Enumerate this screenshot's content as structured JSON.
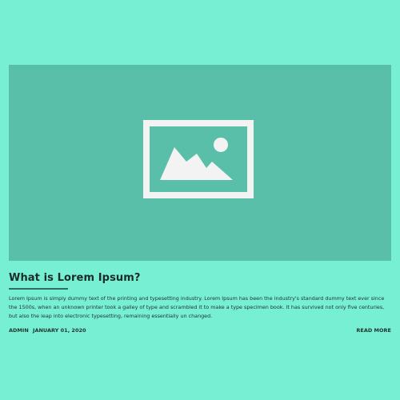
{
  "post": {
    "title": "What is Lorem Ipsum?",
    "excerpt": "Lorem Ipsum is simply dummy text of the printing and typesetting industry. Lorem Ipsum has been the industry's standard dummy text ever since the 1500s, when an unknown printer took a galley of type and scrambled it to make a type specimen book. It has survived not only five centuries, but also the leap into electronic typesetting, remaining essentially un changed.",
    "author": "ADMIN",
    "date": "JANUARY 01, 2020",
    "read_more_label": "READ MORE",
    "image_icon": "image-placeholder-icon"
  },
  "colors": {
    "page_background": "#76efd3",
    "image_background": "#5abfa9",
    "icon_color": "#f3f3f3",
    "title_rule": "#2f6d62",
    "text": "#233533"
  }
}
